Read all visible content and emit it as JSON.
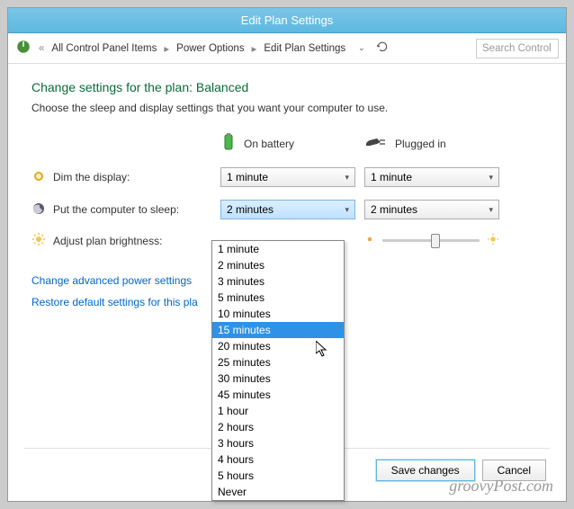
{
  "window": {
    "title": "Edit Plan Settings"
  },
  "breadcrumb": {
    "items": [
      "All Control Panel Items",
      "Power Options",
      "Edit Plan Settings"
    ]
  },
  "search": {
    "placeholder": "Search Control"
  },
  "page": {
    "heading": "Change settings for the plan: Balanced",
    "sub": "Choose the sleep and display settings that you want your computer to use."
  },
  "columns": {
    "battery": "On battery",
    "plugged": "Plugged in"
  },
  "rows": {
    "dim": {
      "label": "Dim the display:",
      "battery": "1 minute",
      "plugged": "1 minute"
    },
    "sleep": {
      "label": "Put the computer to sleep:",
      "battery": "2 minutes",
      "plugged": "2 minutes"
    },
    "brightness": {
      "label": "Adjust plan brightness:"
    }
  },
  "dropdown_options": [
    "1 minute",
    "2 minutes",
    "3 minutes",
    "5 minutes",
    "10 minutes",
    "15 minutes",
    "20 minutes",
    "25 minutes",
    "30 minutes",
    "45 minutes",
    "1 hour",
    "2 hours",
    "3 hours",
    "4 hours",
    "5 hours",
    "Never"
  ],
  "dropdown_hover": "15 minutes",
  "links": {
    "advanced": "Change advanced power settings",
    "restore": "Restore default settings for this pla"
  },
  "buttons": {
    "save": "Save changes",
    "cancel": "Cancel"
  },
  "watermark": "groovyPost.com"
}
